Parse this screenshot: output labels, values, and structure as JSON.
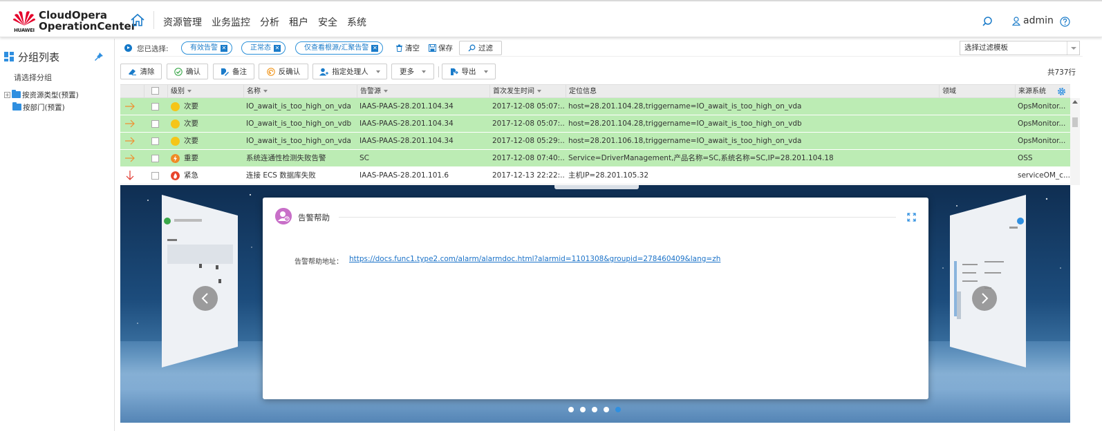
{
  "brand": {
    "company": "HUAWEI",
    "name_line1": "CloudOpera",
    "name_line2": "OperationCenter",
    "logo_color": "#e4002b"
  },
  "nav": {
    "items": [
      "资源管理",
      "业务监控",
      "分析",
      "租户",
      "安全",
      "系统"
    ]
  },
  "header": {
    "user": "admin"
  },
  "sidebar": {
    "title": "分组列表",
    "select_hint": "请选择分组",
    "tree": [
      "按资源类型(预置)",
      "按部门(预置)"
    ]
  },
  "filter": {
    "selected_label": "您已选择:",
    "chips": [
      "有效告警",
      "正常态",
      "仅查看根源/汇聚告警"
    ],
    "clear": "清空",
    "save": "保存",
    "filter_btn": "过滤",
    "template_placeholder": "选择过滤模板"
  },
  "toolbar": {
    "clear": "清除",
    "confirm": "确认",
    "note": "备注",
    "unconfirm": "反确认",
    "assign": "指定处理人",
    "more": "更多",
    "export": "导出",
    "total": "共737行"
  },
  "table": {
    "headers": {
      "level": "级别",
      "name": "名称",
      "source": "告警源",
      "first_time": "首次发生时间",
      "location": "定位信息",
      "domain": "领域",
      "system": "来源系统"
    },
    "rows": [
      {
        "level": "次要",
        "name": "IO_await_is_too_high_on_vda",
        "source": "IAAS-PAAS-28.201.104.34",
        "time": "2017-12-08 05:07:...",
        "location": "host=28.201.104.28,triggername=IO_await_is_too_high_on_vda",
        "domain": "",
        "system": "OpsMonitor..."
      },
      {
        "level": "次要",
        "name": "IO_await_is_too_high_on_vdb",
        "source": "IAAS-PAAS-28.201.104.34",
        "time": "2017-12-08 05:07:...",
        "location": "host=28.201.104.28,triggername=IO_await_is_too_high_on_vdb",
        "domain": "",
        "system": "OpsMonitor..."
      },
      {
        "level": "次要",
        "name": "IO_await_is_too_high_on_vda",
        "source": "IAAS-PAAS-28.201.104.34",
        "time": "2017-12-08 05:29:...",
        "location": "host=28.201.106.18,triggername=IO_await_is_too_high_on_vda",
        "domain": "",
        "system": "OpsMonitor..."
      },
      {
        "level": "重要",
        "name": "系统连通性检测失败告警",
        "source": "SC",
        "time": "2017-12-08 07:40:...",
        "location": "Service=DriverManagement,产品名称=SC,系统名称=SC,IP=28.201.104.18",
        "domain": "",
        "system": "OSS"
      },
      {
        "level": "紧急",
        "name": "连接 ECS 数据库失败",
        "source": "IAAS-PAAS-28.201.101.6",
        "time": "2017-12-13 22:22:...",
        "location": "主机IP=28.201.105.32",
        "domain": "",
        "system": "serviceOM_c..."
      }
    ]
  },
  "help": {
    "title": "告警帮助",
    "address_label": "告警帮助地址：",
    "address_url": "https://docs.func1.type2.com/alarm/alarmdoc.html?alarmid=1101308&groupid=278460409&lang=zh"
  },
  "colors": {
    "accent": "#1a7bc9",
    "row_green": "#bcecb4",
    "minor": "#f5c518",
    "major": "#f08a24",
    "critical": "#e8452c"
  }
}
